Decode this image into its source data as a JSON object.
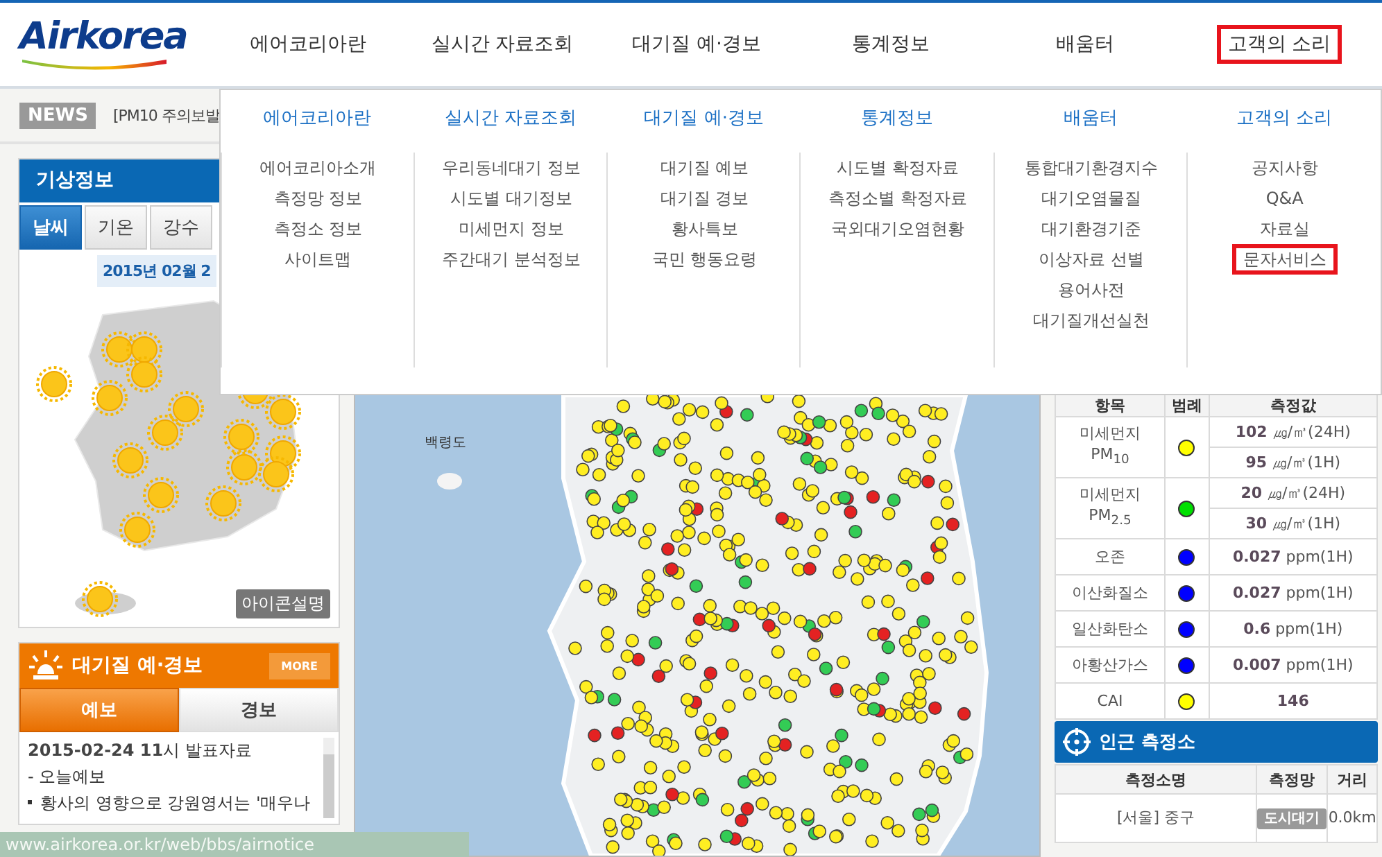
{
  "header": {
    "logo": "Airkorea",
    "nav": [
      {
        "label": "에어코리아란",
        "selected": false
      },
      {
        "label": "실시간 자료조회",
        "selected": false
      },
      {
        "label": "대기질 예·경보",
        "selected": false
      },
      {
        "label": "통계정보",
        "selected": false
      },
      {
        "label": "배움터",
        "selected": false
      },
      {
        "label": "고객의 소리",
        "selected": true
      }
    ]
  },
  "mega_menu": {
    "columns": [
      {
        "heading": "에어코리아란",
        "items": [
          {
            "label": "에어코리아소개",
            "selected": false
          },
          {
            "label": "측정망 정보",
            "selected": false
          },
          {
            "label": "측정소 정보",
            "selected": false
          },
          {
            "label": "사이트맵",
            "selected": false
          }
        ]
      },
      {
        "heading": "실시간 자료조회",
        "items": [
          {
            "label": "우리동네대기 정보",
            "selected": false
          },
          {
            "label": "시도별 대기정보",
            "selected": false
          },
          {
            "label": "미세먼지 정보",
            "selected": false
          },
          {
            "label": "주간대기 분석정보",
            "selected": false
          }
        ]
      },
      {
        "heading": "대기질 예·경보",
        "items": [
          {
            "label": "대기질 예보",
            "selected": false
          },
          {
            "label": "대기질 경보",
            "selected": false
          },
          {
            "label": "황사특보",
            "selected": false
          },
          {
            "label": "국민 행동요령",
            "selected": false
          }
        ]
      },
      {
        "heading": "통계정보",
        "items": [
          {
            "label": "시도별 확정자료",
            "selected": false
          },
          {
            "label": "측정소별 확정자료",
            "selected": false
          },
          {
            "label": "국외대기오염현황",
            "selected": false
          }
        ]
      },
      {
        "heading": "배움터",
        "items": [
          {
            "label": "통합대기환경지수",
            "selected": false
          },
          {
            "label": "대기오염물질",
            "selected": false
          },
          {
            "label": "대기환경기준",
            "selected": false
          },
          {
            "label": "이상자료 선별",
            "selected": false
          },
          {
            "label": "용어사전",
            "selected": false
          },
          {
            "label": "대기질개선실천",
            "selected": false
          }
        ]
      },
      {
        "heading": "고객의 소리",
        "items": [
          {
            "label": "공지사항",
            "selected": false
          },
          {
            "label": "Q&A",
            "selected": false
          },
          {
            "label": "자료실",
            "selected": false
          },
          {
            "label": "문자서비스",
            "selected": true
          }
        ]
      }
    ]
  },
  "news": {
    "badge": "NEWS",
    "headline": "[PM10 주의보발"
  },
  "weather": {
    "title": "기상정보",
    "tabs": [
      {
        "label": "날씨",
        "selected": true
      },
      {
        "label": "기온",
        "selected": false
      },
      {
        "label": "강수",
        "selected": false
      }
    ],
    "date": "2015년 02월 2",
    "legend_button": "아이콘설명"
  },
  "forecast": {
    "title": "대기질 예·경보",
    "more": "MORE",
    "tabs": [
      {
        "label": "예보",
        "selected": true
      },
      {
        "label": "경보",
        "selected": false
      }
    ],
    "issued": "**2015-02-24 11**시 발표자료",
    "section": "- 오늘예보",
    "bullets": [
      "황사의 영향으로 강원영서는 '매우나"
    ]
  },
  "map": {
    "island_label": "백령도"
  },
  "air_table": {
    "columns": [
      "항목",
      "범례",
      "측정값"
    ],
    "rows": [
      {
        "kind": "pollutant",
        "item": "미세먼지 PM$_{10}$",
        "color": "#ffff00",
        "values": [
          "**102** ㎍/㎥(24H)",
          "**95** ㎍/㎥(1H)"
        ]
      },
      {
        "kind": "pollutant",
        "item": "미세먼지 PM$_{2.5}$",
        "color": "#00e000",
        "values": [
          "**20** ㎍/㎥(24H)",
          "**30** ㎍/㎥(1H)"
        ]
      },
      {
        "kind": "pollutant",
        "item": "오존",
        "color": "#0000ff",
        "values": [
          "**0.027** ppm(1H)"
        ]
      },
      {
        "kind": "pollutant",
        "item": "이산화질소",
        "color": "#0000ff",
        "values": [
          "**0.027** ppm(1H)"
        ]
      },
      {
        "kind": "pollutant",
        "item": "일산화탄소",
        "color": "#0000ff",
        "values": [
          "**0.6** ppm(1H)"
        ]
      },
      {
        "kind": "pollutant",
        "item": "아황산가스",
        "color": "#0000ff",
        "values": [
          "**0.007** ppm(1H)"
        ]
      },
      {
        "kind": "index",
        "item": "CAI",
        "color": "#ffff00",
        "values": [
          "146"
        ]
      }
    ]
  },
  "nearby": {
    "title": "인근 측정소",
    "columns": [
      "측정소명",
      "측정망",
      "거리"
    ],
    "rows": [
      {
        "station": "[서울] 중구",
        "network": "도시대기",
        "distance": "0.0km"
      }
    ]
  },
  "status_bar": {
    "url": "www.airkorea.or.kr/web/bbs/airnotice"
  }
}
